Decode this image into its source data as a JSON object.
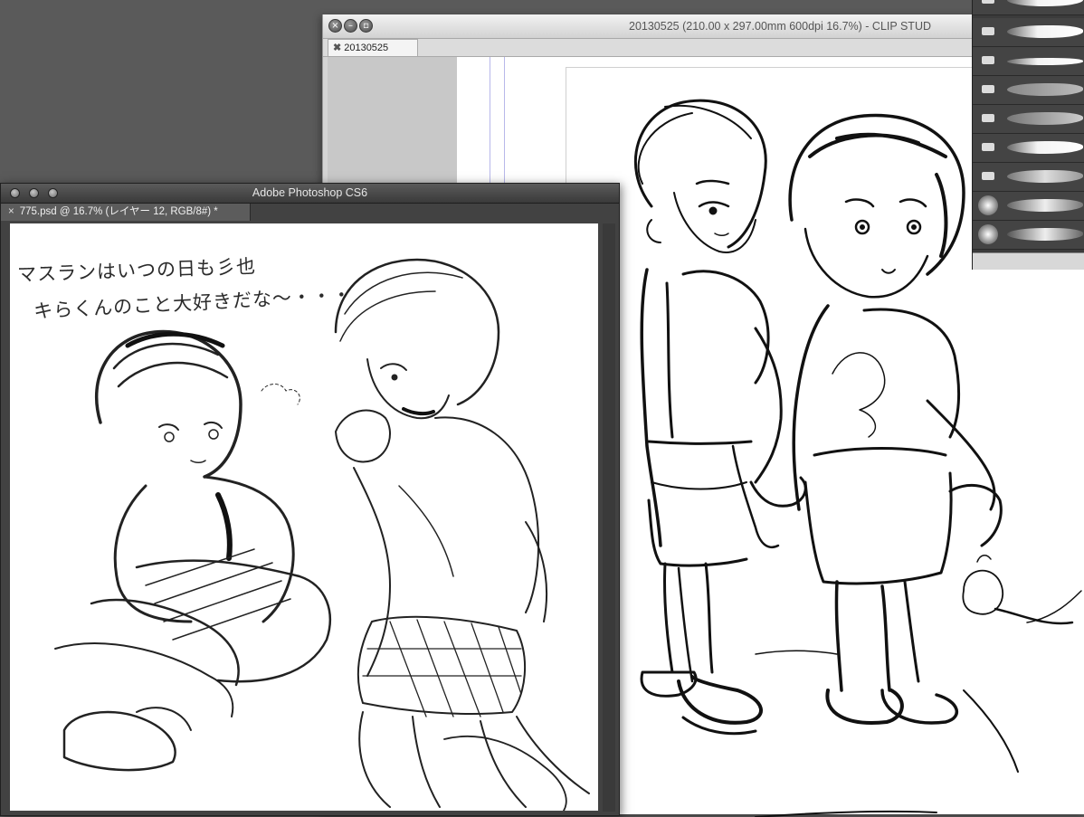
{
  "clip_studio": {
    "window_title": "20130525 (210.00 x 297.00mm 600dpi 16.7%)  - CLIP STUD",
    "tab_label": "20130525",
    "tab_close_glyph": "✖",
    "window_buttons": [
      "close",
      "minimize",
      "zoom"
    ],
    "canvas_bg": "#ffffff",
    "panel_bg": "#c8c8c8"
  },
  "brush_panel": {
    "rows": [
      {
        "icon": "pen-icon"
      },
      {
        "icon": "brush-icon"
      },
      {
        "icon": "pen-icon"
      },
      {
        "icon": "marker-icon"
      },
      {
        "icon": "marker-icon"
      },
      {
        "icon": "chisel-icon"
      },
      {
        "icon": "airbrush-icon"
      },
      {
        "icon": "soft-round-icon"
      },
      {
        "icon": "soft-round-icon"
      }
    ]
  },
  "photoshop": {
    "window_title": "Adobe Photoshop CS6",
    "doc_tab": "775.psd @ 16.7% (レイヤー 12, RGB/8#) *",
    "doc_tab_close": "×",
    "handwritten_line1": "マスランはいつの日も彡也",
    "handwritten_line2": "キらくんのこと大好きだな～・・・"
  },
  "colors": {
    "desktop": "#5a5a5a",
    "ps_chrome": "#424242",
    "ink": "#111111"
  }
}
